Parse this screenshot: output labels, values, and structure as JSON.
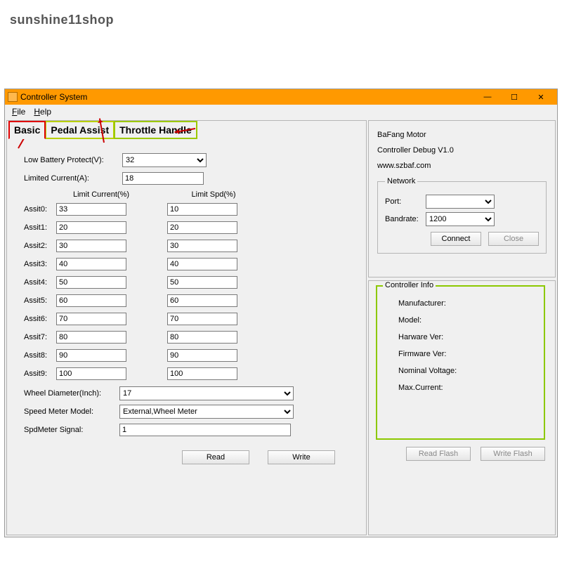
{
  "watermark": "sunshine11shop",
  "window": {
    "title": "Controller System"
  },
  "menu": {
    "file": "File",
    "help": "Help"
  },
  "tabs": {
    "basic": "Basic",
    "pedal": "Pedal Assist",
    "throttle": "Throttle Handle"
  },
  "form": {
    "low_battery_label": "Low Battery Protect(V):",
    "low_battery_value": "32",
    "limited_current_label": "Limited Current(A):",
    "limited_current_value": "18",
    "limit_current_header": "Limit Current(%)",
    "limit_spd_header": "Limit Spd(%)",
    "assist_labels": [
      "Assit0:",
      "Assit1:",
      "Assit2:",
      "Assit3:",
      "Assit4:",
      "Assit5:",
      "Assit6:",
      "Assit7:",
      "Assit8:",
      "Assit9:"
    ],
    "assist_current": [
      "33",
      "20",
      "30",
      "40",
      "50",
      "60",
      "70",
      "80",
      "90",
      "100"
    ],
    "assist_spd": [
      "10",
      "20",
      "30",
      "40",
      "50",
      "60",
      "70",
      "80",
      "90",
      "100"
    ],
    "wheel_label": "Wheel Diameter(Inch):",
    "wheel_value": "17",
    "speed_meter_label": "Speed Meter Model:",
    "speed_meter_value": "External,Wheel Meter",
    "spd_signal_label": "SpdMeter Signal:",
    "spd_signal_value": "1",
    "read_btn": "Read",
    "write_btn": "Write"
  },
  "right": {
    "brand": "BaFang Motor",
    "debug": "Controller Debug V1.0",
    "url": "www.szbaf.com",
    "network_legend": "Network",
    "port_label": "Port:",
    "port_value": "",
    "bandrate_label": "Bandrate:",
    "bandrate_value": "1200",
    "connect_btn": "Connect",
    "close_btn": "Close",
    "controller_legend": "Controller Info",
    "ci_labels": [
      "Manufacturer:",
      "Model:",
      "Harware Ver:",
      "Firmware Ver:",
      "Nominal Voltage:",
      "Max.Current:"
    ],
    "read_flash": "Read Flash",
    "write_flash": "Write Flash"
  }
}
